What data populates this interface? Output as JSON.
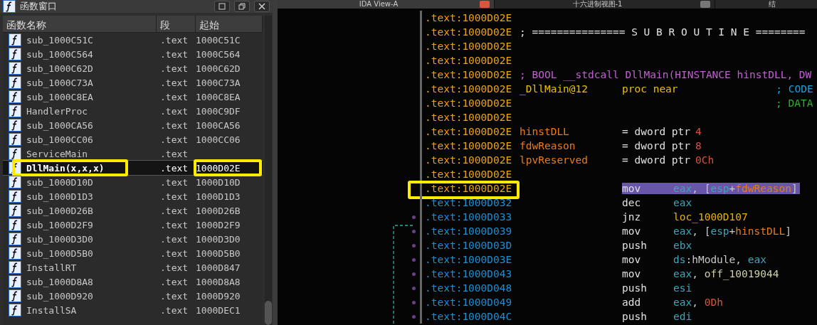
{
  "functions_window": {
    "title": "函数窗口",
    "columns": [
      "函数名称",
      "段",
      "起始"
    ],
    "rows": [
      {
        "name": "sub_1000C51C",
        "segment": ".text",
        "start": "1000C51C",
        "selected": false,
        "annotated": false
      },
      {
        "name": "sub_1000C564",
        "segment": ".text",
        "start": "1000C564",
        "selected": false,
        "annotated": false
      },
      {
        "name": "sub_1000C62D",
        "segment": ".text",
        "start": "1000C62D",
        "selected": false,
        "annotated": false
      },
      {
        "name": "sub_1000C73A",
        "segment": ".text",
        "start": "1000C73A",
        "selected": false,
        "annotated": false
      },
      {
        "name": "sub_1000C8EA",
        "segment": ".text",
        "start": "1000C8EA",
        "selected": false,
        "annotated": false
      },
      {
        "name": "HandlerProc",
        "segment": ".text",
        "start": "1000C9DF",
        "selected": false,
        "annotated": false
      },
      {
        "name": "sub_1000CA56",
        "segment": ".text",
        "start": "1000CA56",
        "selected": false,
        "annotated": false
      },
      {
        "name": "sub_1000CC06",
        "segment": ".text",
        "start": "1000CC06",
        "selected": false,
        "annotated": false
      },
      {
        "name": "ServiceMain",
        "segment": ".text",
        "selected": false,
        "annotated": false
      },
      {
        "name": "DllMain(x,x,x)",
        "segment": ".text",
        "start": "1000D02E",
        "selected": true,
        "annotated": true
      },
      {
        "name": "sub_1000D10D",
        "segment": ".text",
        "start": "1000D10D",
        "selected": false,
        "annotated": false
      },
      {
        "name": "sub_1000D1D3",
        "segment": ".text",
        "start": "1000D1D3",
        "selected": false,
        "annotated": false
      },
      {
        "name": "sub_1000D26B",
        "segment": ".text",
        "start": "1000D26B",
        "selected": false,
        "annotated": false
      },
      {
        "name": "sub_1000D2F9",
        "segment": ".text",
        "start": "1000D2F9",
        "selected": false,
        "annotated": false
      },
      {
        "name": "sub_1000D3D0",
        "segment": ".text",
        "start": "1000D3D0",
        "selected": false,
        "annotated": false
      },
      {
        "name": "sub_1000D5B0",
        "segment": ".text",
        "start": "1000D5B0",
        "selected": false,
        "annotated": false
      },
      {
        "name": "InstallRT",
        "segment": ".text",
        "start": "1000D847",
        "selected": false,
        "annotated": false
      },
      {
        "name": "sub_1000D8A8",
        "segment": ".text",
        "start": "1000D8A8",
        "selected": false,
        "annotated": false
      },
      {
        "name": "sub_1000D920",
        "segment": ".text",
        "start": "1000D920",
        "selected": false,
        "annotated": false
      },
      {
        "name": "InstallSA",
        "segment": ".text",
        "start": "1000DEC1",
        "selected": false,
        "annotated": false
      }
    ]
  },
  "tabs": [
    {
      "label": "IDA View-A",
      "selected": true
    },
    {
      "label": "十六进制视图-1",
      "selected": false
    },
    {
      "label": "结",
      "selected": false
    }
  ],
  "listing": [
    {
      "address": ".text:1000D02E",
      "kind": "header",
      "annotated": false,
      "flow_dot": false
    },
    {
      "address": ".text:1000D02E",
      "kind": "header",
      "label": {
        "text": "; =============== S U B R O U T I N E ========",
        "kind": "separator"
      },
      "annotated": false,
      "flow_dot": false
    },
    {
      "address": ".text:1000D02E",
      "kind": "header",
      "annotated": false,
      "flow_dot": false
    },
    {
      "address": ".text:1000D02E",
      "kind": "header",
      "annotated": false,
      "flow_dot": false
    },
    {
      "address": ".text:1000D02E",
      "kind": "header",
      "label": {
        "text": "; BOOL __stdcall DllMain(HINSTANCE hinstDLL, DW",
        "kind": "prototype"
      },
      "annotated": false,
      "flow_dot": false
    },
    {
      "address": ".text:1000D02E",
      "kind": "header",
      "label": {
        "text": "_DllMain@12",
        "kind": "procname"
      },
      "mnemonic": {
        "text": "proc near",
        "kind": "proc"
      },
      "comment": {
        "text": "; CODE",
        "kind": "code_xref"
      },
      "highlighted": false,
      "annotated": false,
      "flow_dot": false
    },
    {
      "address": ".text:1000D02E",
      "kind": "header",
      "comment": {
        "text": "; DATA",
        "kind": "data_xref"
      },
      "annotated": false,
      "flow_dot": false
    },
    {
      "address": ".text:1000D02E",
      "kind": "header",
      "annotated": false,
      "flow_dot": false
    },
    {
      "address": ".text:1000D02E",
      "kind": "header",
      "label": {
        "text": "hinstDLL",
        "kind": "variable"
      },
      "mnemonic": {
        "text": "= dword ptr",
        "kind": "directive"
      },
      "operands": [
        {
          "text": "4",
          "kind": "number"
        }
      ],
      "highlighted": false,
      "annotated": false,
      "flow_dot": false
    },
    {
      "address": ".text:1000D02E",
      "kind": "header",
      "label": {
        "text": "fdwReason",
        "kind": "variable"
      },
      "mnemonic": {
        "text": "= dword ptr",
        "kind": "directive"
      },
      "operands": [
        {
          "text": "8",
          "kind": "number"
        }
      ],
      "highlighted": false,
      "annotated": false,
      "flow_dot": false
    },
    {
      "address": ".text:1000D02E",
      "kind": "header",
      "label": {
        "text": "lpvReserved",
        "kind": "variable"
      },
      "mnemonic": {
        "text": "= dword ptr",
        "kind": "directive"
      },
      "operands": [
        {
          "text": "0Ch",
          "kind": "number"
        }
      ],
      "highlighted": false,
      "annotated": false,
      "flow_dot": false
    },
    {
      "address": ".text:1000D02E",
      "kind": "header",
      "annotated": false,
      "flow_dot": false
    },
    {
      "address": ".text:1000D02E",
      "kind": "header",
      "mnemonic": {
        "text": "mov",
        "kind": "instruction"
      },
      "operands": [
        {
          "text": "eax",
          "kind": "register"
        },
        {
          "text": ", [",
          "kind": "plain"
        },
        {
          "text": "esp",
          "kind": "register"
        },
        {
          "text": "+",
          "kind": "plain"
        },
        {
          "text": "fdwReason",
          "kind": "variable"
        },
        {
          "text": "]",
          "kind": "plain"
        }
      ],
      "highlighted": true,
      "annotated": true,
      "flow_dot": false
    },
    {
      "address": ".text:1000D032",
      "kind": "code",
      "mnemonic": {
        "text": "dec",
        "kind": "instruction"
      },
      "operands": [
        {
          "text": "eax",
          "kind": "register"
        }
      ],
      "highlighted": false,
      "annotated": false,
      "flow_dot": false
    },
    {
      "address": ".text:1000D033",
      "kind": "code",
      "mnemonic": {
        "text": "jnz",
        "kind": "instruction"
      },
      "operands": [
        {
          "text": "loc_1000D107",
          "kind": "location"
        }
      ],
      "highlighted": false,
      "annotated": false,
      "flow_dot": true
    },
    {
      "address": ".text:1000D039",
      "kind": "code",
      "mnemonic": {
        "text": "mov",
        "kind": "instruction"
      },
      "operands": [
        {
          "text": "eax",
          "kind": "register"
        },
        {
          "text": ", [",
          "kind": "plain"
        },
        {
          "text": "esp",
          "kind": "register"
        },
        {
          "text": "+",
          "kind": "plain"
        },
        {
          "text": "hinstDLL",
          "kind": "variable"
        },
        {
          "text": "]",
          "kind": "plain"
        }
      ],
      "highlighted": false,
      "annotated": false,
      "flow_dot": true
    },
    {
      "address": ".text:1000D03D",
      "kind": "code",
      "mnemonic": {
        "text": "push",
        "kind": "instruction"
      },
      "operands": [
        {
          "text": "ebx",
          "kind": "register"
        }
      ],
      "highlighted": false,
      "annotated": false,
      "flow_dot": true
    },
    {
      "address": ".text:1000D03E",
      "kind": "code",
      "mnemonic": {
        "text": "mov",
        "kind": "instruction"
      },
      "operands": [
        {
          "text": "ds",
          "kind": "register"
        },
        {
          "text": ":hModule, ",
          "kind": "plain"
        },
        {
          "text": "eax",
          "kind": "register"
        }
      ],
      "highlighted": false,
      "annotated": false,
      "flow_dot": true
    },
    {
      "address": ".text:1000D043",
      "kind": "code",
      "mnemonic": {
        "text": "mov",
        "kind": "instruction"
      },
      "operands": [
        {
          "text": "eax",
          "kind": "register"
        },
        {
          "text": ", ",
          "kind": "plain"
        },
        {
          "text": "off_10019044",
          "kind": "data"
        }
      ],
      "highlighted": false,
      "annotated": false,
      "flow_dot": true
    },
    {
      "address": ".text:1000D048",
      "kind": "code",
      "mnemonic": {
        "text": "push",
        "kind": "instruction"
      },
      "operands": [
        {
          "text": "esi",
          "kind": "register"
        }
      ],
      "highlighted": false,
      "annotated": false,
      "flow_dot": true
    },
    {
      "address": ".text:1000D049",
      "kind": "code",
      "mnemonic": {
        "text": "add",
        "kind": "instruction"
      },
      "operands": [
        {
          "text": "eax",
          "kind": "register"
        },
        {
          "text": ", ",
          "kind": "plain"
        },
        {
          "text": "0Dh",
          "kind": "number"
        }
      ],
      "highlighted": false,
      "annotated": false,
      "flow_dot": true
    },
    {
      "address": ".text:1000D04C",
      "kind": "code",
      "mnemonic": {
        "text": "push",
        "kind": "instruction"
      },
      "operands": [
        {
          "text": "edi",
          "kind": "register"
        }
      ],
      "highlighted": false,
      "annotated": false,
      "flow_dot": true
    }
  ]
}
